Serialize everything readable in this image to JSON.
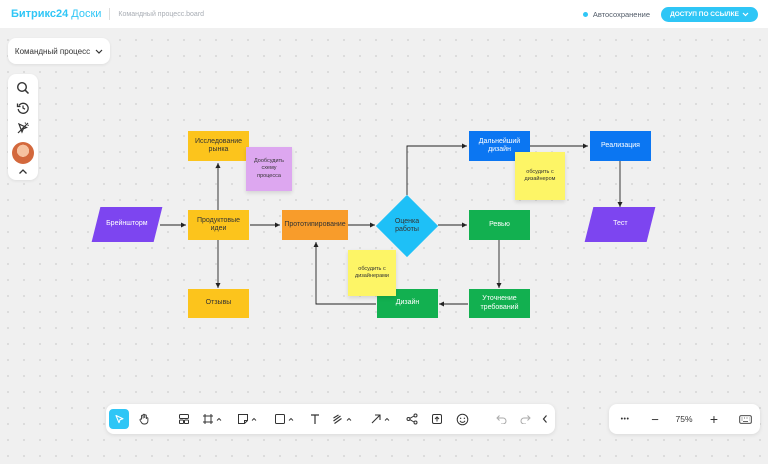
{
  "app": {
    "logo_main": "Битрикс24",
    "logo_sub": "Доски",
    "board_name": "Командный процесс.board"
  },
  "header": {
    "autosave": "Автосохранение",
    "share_label": "ДОСТУП ПО ССЫЛКЕ"
  },
  "process_selector": {
    "label": "Командный процесс"
  },
  "left_toolbar": {
    "icons": [
      "search-icon",
      "history-icon",
      "pointer-off-icon",
      "avatar",
      "chevron-up-icon"
    ]
  },
  "flow": {
    "brainstorm": "Брейншторм",
    "market_research": "Исследование рынка",
    "product_ideas": "Продуктовые идеи",
    "reviews": "Отзывы",
    "prototyping": "Прототипирование",
    "evaluation": "Оценка работы",
    "further_design": "Дальнейший дизайн",
    "implementation": "Реализация",
    "test": "Тест",
    "review": "Ревью",
    "clarify_requirements": "Уточнение требований",
    "design": "Дизайн"
  },
  "notes": {
    "discuss_scheme": "Дообсудить схему процесса",
    "discuss_designer": "обсудить с дизайнером",
    "discuss_designers": "обсудить с дизайнерами"
  },
  "colors": {
    "yellow": "#fcc41c",
    "orange": "#f89c2b",
    "green": "#12b050",
    "blue": "#0b76f2",
    "purple": "#7d45f0",
    "cyan": "#1ec0f7",
    "note_yellow": "#fdf566",
    "note_purple": "#dda7f0",
    "accent": "#2fc6f6"
  },
  "bottom_toolbar": {
    "icons": [
      "select-icon",
      "hand-icon",
      "frame-layout-icon",
      "frame-icon",
      "sticker-icon",
      "shape-icon",
      "text-icon",
      "pen-icon",
      "arrow-icon",
      "connector-icon",
      "upload-icon",
      "emoji-icon",
      "undo-icon",
      "redo-icon",
      "collapse-icon"
    ]
  },
  "zoom": {
    "more": "•••",
    "minus": "−",
    "value": "75%",
    "plus": "+",
    "keyboard": "keyboard-icon"
  }
}
